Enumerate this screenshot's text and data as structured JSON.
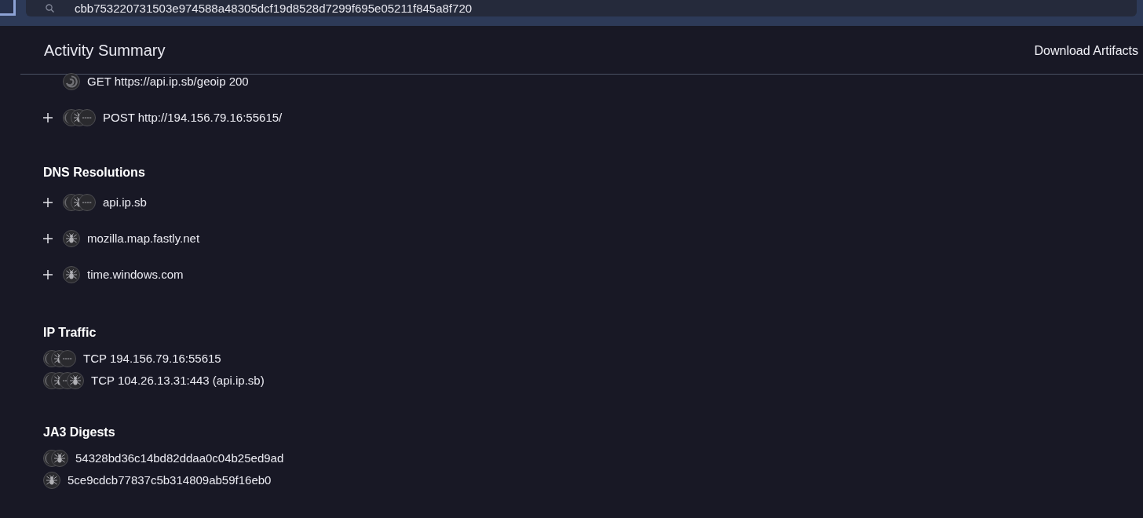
{
  "search": {
    "value": "cbb753220731503e974588a48305dcf19d8528d7299f695e05211f845a8f720"
  },
  "header": {
    "title": "Activity Summary",
    "action": "Download Artifacts"
  },
  "sections": [
    {
      "rows": [
        {
          "expandable": false,
          "sources": [
            {
              "kind": "swirl"
            }
          ],
          "text": "GET https://api.ip.sb/geoip 200"
        },
        {
          "expandable": true,
          "sources": [
            {
              "kind": "crescent"
            },
            {
              "kind": "spider"
            },
            {
              "kind": "dashes"
            }
          ],
          "text": "POST http://194.156.79.16:55615/"
        }
      ]
    },
    {
      "title": "DNS Resolutions",
      "rows": [
        {
          "expandable": true,
          "sources": [
            {
              "kind": "crescent"
            },
            {
              "kind": "spider"
            },
            {
              "kind": "dashes"
            }
          ],
          "text": "api.ip.sb"
        },
        {
          "expandable": true,
          "sources": [
            {
              "kind": "spider"
            }
          ],
          "text": "mozilla.map.fastly.net"
        },
        {
          "expandable": true,
          "sources": [
            {
              "kind": "spider"
            }
          ],
          "text": "time.windows.com"
        }
      ]
    },
    {
      "title": "IP Traffic",
      "rows": [
        {
          "sources": [
            {
              "kind": "crescent"
            },
            {
              "kind": "spider"
            },
            {
              "kind": "dashes"
            }
          ],
          "text": "TCP 194.156.79.16:55615"
        },
        {
          "sources": [
            {
              "kind": "crescent"
            },
            {
              "kind": "spider"
            },
            {
              "kind": "dashes"
            },
            {
              "kind": "spider"
            }
          ],
          "text": "TCP 104.26.13.31:443 (api.ip.sb)"
        }
      ]
    },
    {
      "title": "JA3 Digests",
      "rows": [
        {
          "sources": [
            {
              "kind": "crescent"
            },
            {
              "kind": "spider"
            }
          ],
          "text": "54328bd36c14bd82ddaa0c04b25ed9ad"
        },
        {
          "sources": [
            {
              "kind": "spider"
            }
          ],
          "text": "5ce9cdcb77837c5b314809ab59f16eb0"
        }
      ]
    }
  ]
}
